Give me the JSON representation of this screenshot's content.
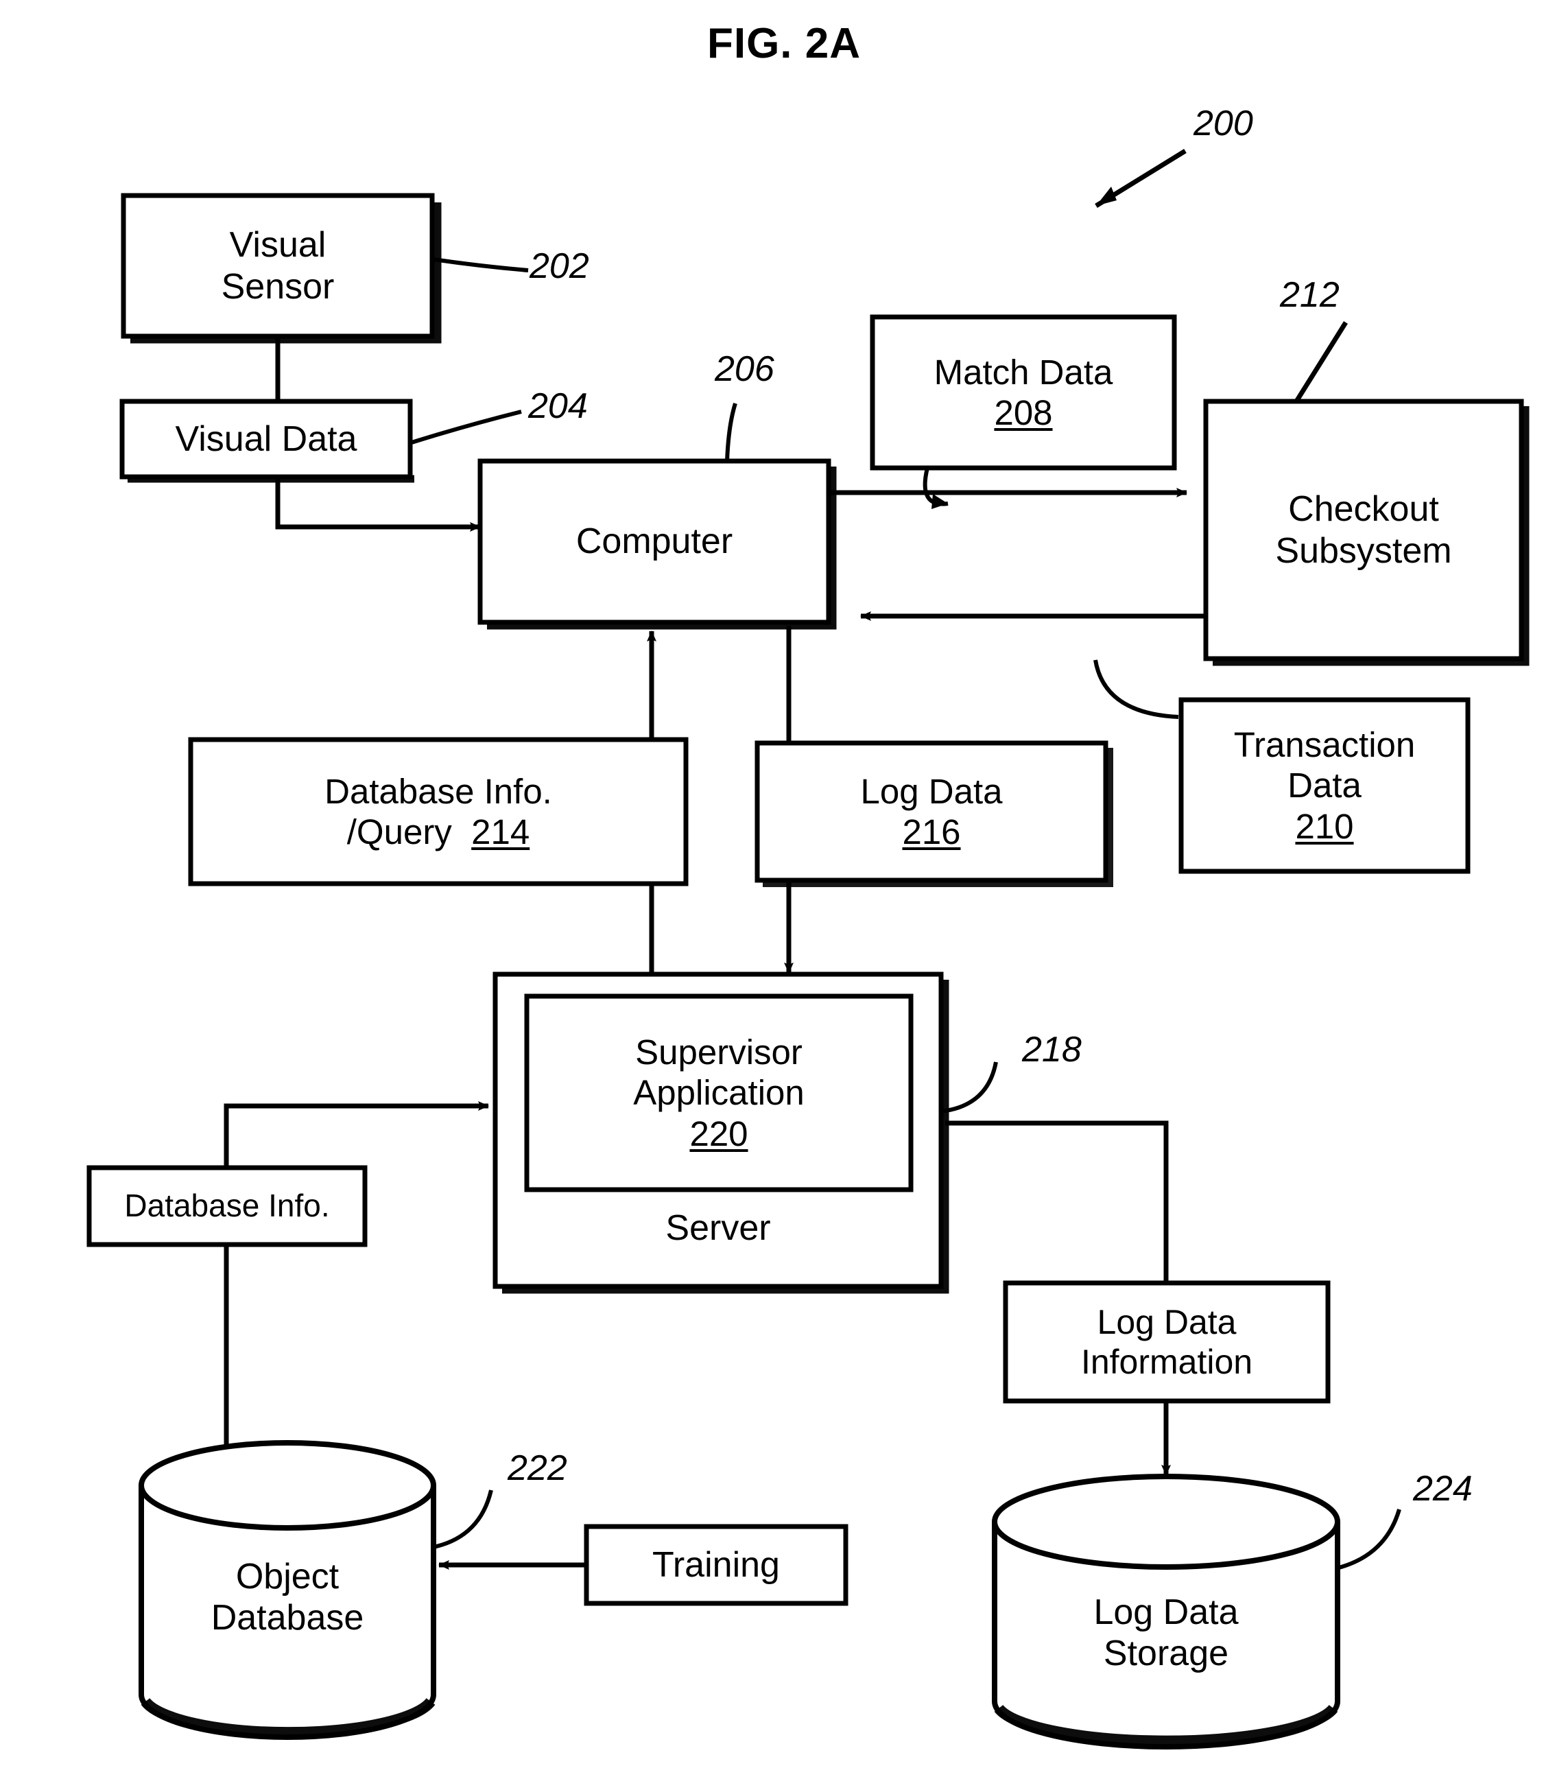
{
  "figure": {
    "title": "FIG. 2A",
    "system_ref": "200"
  },
  "nodes": {
    "visual_sensor": {
      "label": "Visual\nSensor",
      "ref": "202"
    },
    "visual_data": {
      "label": "Visual Data",
      "ref": "204"
    },
    "computer": {
      "label": "Computer",
      "ref": "206"
    },
    "match_data": {
      "label": "Match Data",
      "ref": "208"
    },
    "checkout_subsystem": {
      "label": "Checkout\nSubsystem",
      "ref": "212"
    },
    "transaction_data": {
      "label": "Transaction\nData",
      "ref": "210"
    },
    "database_info_query": {
      "label": "Database Info.\n/Query",
      "ref": "214"
    },
    "log_data": {
      "label": "Log Data",
      "ref": "216"
    },
    "server": {
      "label": "Server",
      "ref": "218"
    },
    "supervisor_application": {
      "label": "Supervisor\nApplication",
      "ref": "220"
    },
    "database_info": {
      "label": "Database Info."
    },
    "object_database": {
      "label": "Object\nDatabase",
      "ref": "222"
    },
    "training": {
      "label": "Training"
    },
    "log_data_information": {
      "label": "Log Data\nInformation"
    },
    "log_data_storage": {
      "label": "Log Data\nStorage",
      "ref": "224"
    }
  },
  "colors": {
    "stroke": "#000000",
    "background": "#ffffff"
  }
}
